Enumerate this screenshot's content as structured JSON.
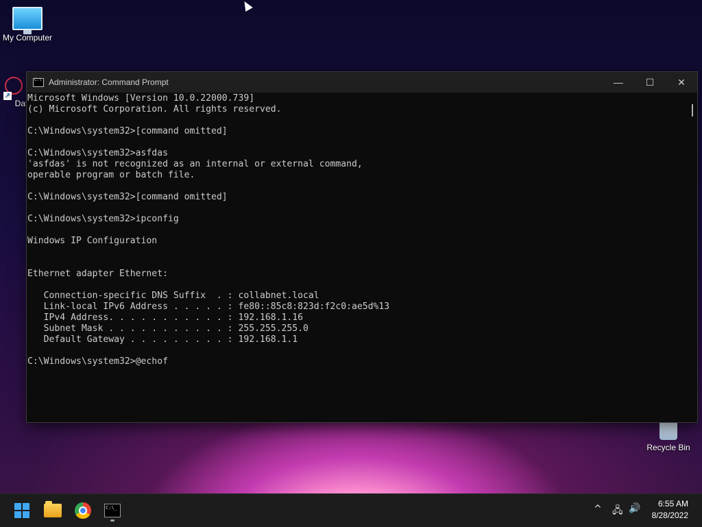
{
  "desktop": {
    "icons": [
      {
        "label": "My Computer"
      },
      {
        "label": "DataW"
      },
      {
        "label": "Recycle Bin"
      }
    ]
  },
  "window": {
    "title": "Administrator: Command Prompt",
    "minimize": "—",
    "maximize": "☐",
    "close": "✕",
    "console_text": "Microsoft Windows [Version 10.0.22000.739]\n(c) Microsoft Corporation. All rights reserved.\n\nC:\\Windows\\system32>[command omitted]\n\nC:\\Windows\\system32>asfdas\n'asfdas' is not recognized as an internal or external command,\noperable program or batch file.\n\nC:\\Windows\\system32>[command omitted]\n\nC:\\Windows\\system32>ipconfig\n\nWindows IP Configuration\n\n\nEthernet adapter Ethernet:\n\n   Connection-specific DNS Suffix  . : collabnet.local\n   Link-local IPv6 Address . . . . . : fe80::85c8:823d:f2c0:ae5d%13\n   IPv4 Address. . . . . . . . . . . : 192.168.1.16\n   Subnet Mask . . . . . . . . . . . : 255.255.255.0\n   Default Gateway . . . . . . . . . : 192.168.1.1\n\nC:\\Windows\\system32>@echof"
  },
  "taskbar": {
    "apps": [
      "Start",
      "File Explorer",
      "Google Chrome",
      "Command Prompt"
    ],
    "tray": {
      "chevron": "^",
      "network": "🖧",
      "volume": "🔊"
    },
    "time": "6:55 AM",
    "date": "8/28/2022"
  }
}
